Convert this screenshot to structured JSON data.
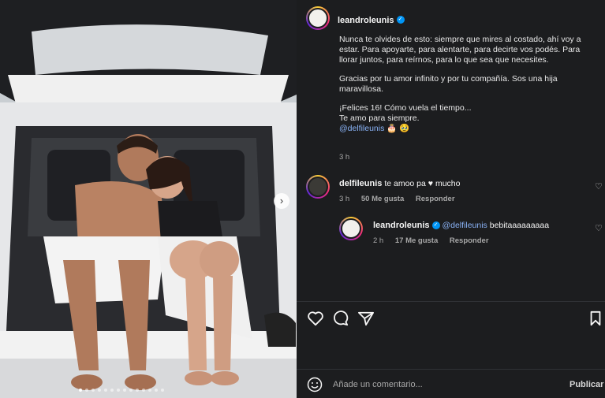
{
  "post": {
    "author": "leandroleunis",
    "caption": {
      "p1": "Nunca te olvides de esto: siempre que mires al costado, ahí voy a estar. Para apoyarte, para alentarte, para decirte vos podés. Para llorar juntos, para reírnos, para lo que sea que necesites.",
      "p2": "Gracias por tu amor infinito y por tu compañía. Sos una hija maravillosa.",
      "p3a": "¡Felices 16! Cómo vuela el tiempo...",
      "p3b": "Te amo para siempre.",
      "mention": "@delfileunis",
      "emojis": "🎂 🥹"
    },
    "time": "3 h"
  },
  "comments": [
    {
      "user": "delfileunis",
      "text_before": "te amoo pa",
      "heart": "♥",
      "text_after": "mucho",
      "time": "3 h",
      "likes": "50 Me gusta",
      "reply": "Responder"
    },
    {
      "user": "leandroleunis",
      "mention": "@delfileunis",
      "text": "bebitaaaaaaaaa",
      "time": "2 h",
      "likes": "17 Me gusta",
      "reply": "Responder"
    }
  ],
  "footer": {
    "placeholder": "Añade un comentario...",
    "publish": "Publicar"
  },
  "icons": {
    "like": "heart-icon",
    "comment": "comment-icon",
    "share": "share-icon",
    "save": "bookmark-icon",
    "emoji": "emoji-icon"
  },
  "carousel": {
    "count": 14,
    "active_index": 0
  },
  "colors": {
    "panel_bg": "#1c1d1f",
    "link": "#8ab4f8",
    "verified": "#0095f6"
  }
}
